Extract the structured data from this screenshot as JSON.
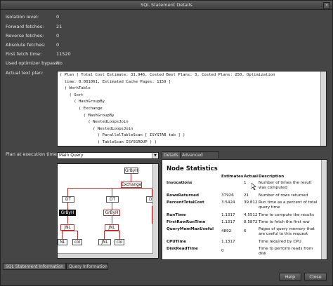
{
  "window": {
    "title": "SQL Statement Details"
  },
  "fields": [
    {
      "label": "Isolation level:",
      "value": "0"
    },
    {
      "label": "Forward fetches:",
      "value": "21"
    },
    {
      "label": "Reverse fetches:",
      "value": "0"
    },
    {
      "label": "Absolute fetches:",
      "value": "0"
    },
    {
      "label": "First fetch time:",
      "value": "11520"
    },
    {
      "label": "Used optimizer bypass:",
      "value": "No"
    }
  ],
  "text_plan": {
    "label": "Actual text plan:",
    "lines": [
      "( Plan [ Total Cost Estimate: 31.946, Costed Best Plans: 3, Costed Plans: 250, Optimization",
      "  time: 0.001061, Estimated Cache Pages: 1159 ]",
      "  ( WorkTable",
      "    ( Sort",
      "      ( HashGroupBy",
      "        ( Exchange",
      "          ( MashGroupBy",
      "            ( NestedLoopsJoin",
      "              ( NestedLoopsJoin",
      "                ( ParallelTableScan [ ISYSTAB tab ] )",
      "                ( TableScan ISYSGROUP ) )"
    ]
  },
  "plan_at_exec": {
    "label": "Plan at execution time:",
    "selected": "Main Query",
    "nodes": [
      "GrByH",
      "Exchange",
      "DT",
      "DT",
      "DT",
      "GrByH",
      "GrByH",
      "JNL",
      "JNL",
      "NL",
      "col",
      "JNL",
      "col"
    ]
  },
  "tabs": [
    {
      "label": "Details"
    },
    {
      "label": "Advanced Details"
    }
  ],
  "stats": {
    "title": "Node Statistics",
    "headers": {
      "estimates": "Estimates",
      "actual": "Actual",
      "description": "Description"
    },
    "rows": [
      {
        "name": "Invocations",
        "estimate": "",
        "actual": "1",
        "description": "Number of times the result was computed"
      },
      {
        "name": "RowsReturned",
        "estimate": "37926",
        "actual": "21",
        "description": "Number of rows returned"
      },
      {
        "name": "PercentTotalCost",
        "estimate": "3.5424",
        "actual": "39.812",
        "description": "Run time as a percent of total query time"
      },
      {
        "name": "RunTime",
        "estimate": "1.1317",
        "actual": "4.5512",
        "description": "Time to compute the results"
      },
      {
        "name": "FirstRowRunTime",
        "estimate": "1.1317",
        "actual": "8.5872",
        "description": "Time to fetch the first row"
      },
      {
        "name": "QueryMemMaxUseful",
        "estimate": "4892",
        "actual": "6",
        "description": "Pages of query memory that are useful to this request"
      },
      {
        "name": "CPUTime",
        "estimate": "1.1317",
        "actual": "",
        "description": "Time required by CPU"
      },
      {
        "name": "DiskReadTime",
        "estimate": "0",
        "actual": "",
        "description": "Time to perform reads from disk"
      }
    ]
  },
  "bottom_tabs": [
    {
      "label": "SQL Statement Information"
    },
    {
      "label": "Query Information"
    }
  ],
  "buttons": {
    "help": "Help",
    "close": "Close"
  }
}
